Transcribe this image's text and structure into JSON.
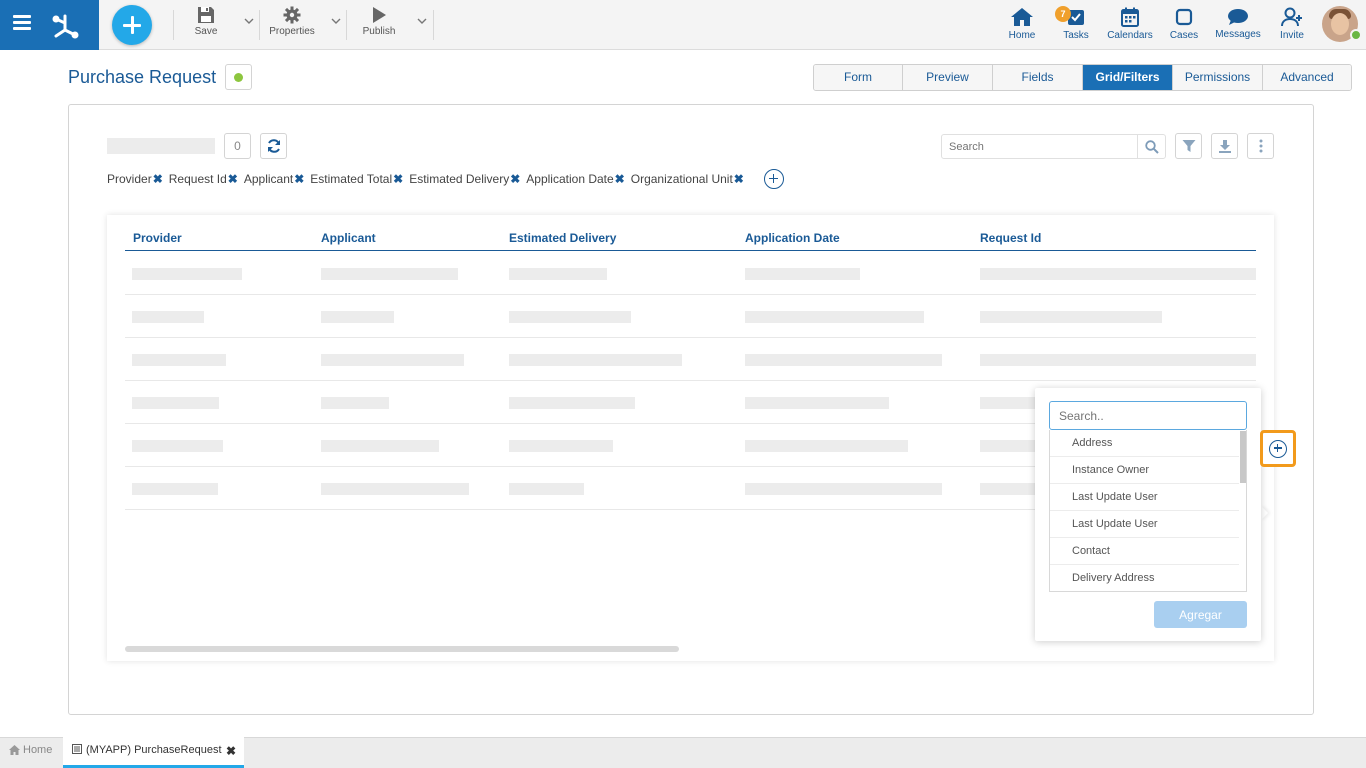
{
  "toolbar": {
    "save_label": "Save",
    "properties_label": "Properties",
    "publish_label": "Publish"
  },
  "nav": {
    "home": "Home",
    "tasks": "Tasks",
    "tasks_badge": "7",
    "calendars": "Calendars",
    "cases": "Cases",
    "messages": "Messages",
    "invite": "Invite"
  },
  "page": {
    "title": "Purchase Request"
  },
  "tabs": [
    {
      "label": "Form"
    },
    {
      "label": "Preview"
    },
    {
      "label": "Fields"
    },
    {
      "label": "Grid/Filters",
      "active": true
    },
    {
      "label": "Permissions"
    },
    {
      "label": "Advanced"
    }
  ],
  "grid_toolbar": {
    "count": "0",
    "search_placeholder": "Search"
  },
  "filter_chips": [
    "Provider",
    "Request Id",
    "Applicant",
    "Estimated Total",
    "Estimated Delivery",
    "Application Date",
    "Organizational Unit"
  ],
  "grid": {
    "columns": [
      "Provider",
      "Applicant",
      "Estimated Delivery",
      "Application Date",
      "Request Id"
    ]
  },
  "add_field_popup": {
    "search_placeholder": "Search..",
    "items": [
      "Address",
      "Instance Owner",
      "Last Update User",
      "Last Update User",
      "Contact",
      "Delivery Address"
    ],
    "button_label": "Agregar"
  },
  "footer": {
    "home_tab": "Home",
    "doc_tab": "(MYAPP) PurchaseRequest",
    "close_glyph": "✖"
  },
  "colors": {
    "brand": "#1a6fb5",
    "accent": "#23a8e8",
    "link": "#1a5a96",
    "highlight": "#f29a1b",
    "status": "#8dc63f"
  }
}
